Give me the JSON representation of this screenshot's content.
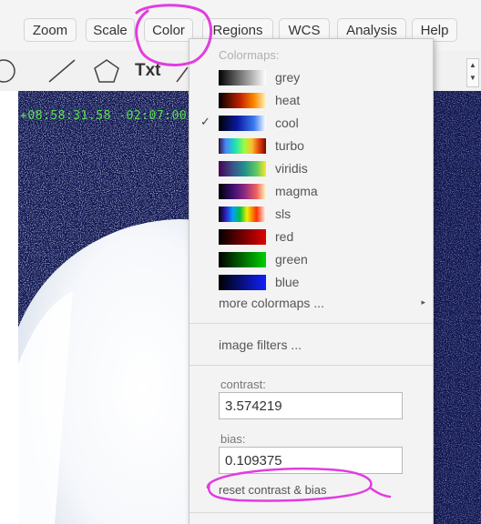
{
  "menubar": {
    "items": [
      {
        "label": "Zoom"
      },
      {
        "label": "Scale"
      },
      {
        "label": "Color"
      },
      {
        "label": "Regions"
      },
      {
        "label": "WCS"
      },
      {
        "label": "Analysis"
      },
      {
        "label": "Help"
      }
    ]
  },
  "toolbar": {
    "txt_label": "Txt",
    "stepper_up": "▲",
    "stepper_down": "▼"
  },
  "image": {
    "coord_text": "+08:58:31.58 -02:07:00"
  },
  "colormenu": {
    "header": "Colormaps:",
    "colormaps": [
      {
        "label": "grey",
        "checked": false
      },
      {
        "label": "heat",
        "checked": false
      },
      {
        "label": "cool",
        "checked": true
      },
      {
        "label": "turbo",
        "checked": false
      },
      {
        "label": "viridis",
        "checked": false
      },
      {
        "label": "magma",
        "checked": false
      },
      {
        "label": "sls",
        "checked": false
      },
      {
        "label": "red",
        "checked": false
      },
      {
        "label": "green",
        "checked": false
      },
      {
        "label": "blue",
        "checked": false
      }
    ],
    "check_glyph": "✓",
    "more_label": "more colormaps ...",
    "more_arrow": "▸",
    "filters_label": "image filters ...",
    "contrast_label": "contrast:",
    "contrast_value": "3.574219",
    "bias_label": "bias:",
    "bias_value": "0.109375",
    "reset_label": "reset contrast & bias"
  },
  "colors": {
    "annotation": "#e23ce0",
    "coord_text": "#58e04c",
    "image_bg": "#0d1450"
  }
}
